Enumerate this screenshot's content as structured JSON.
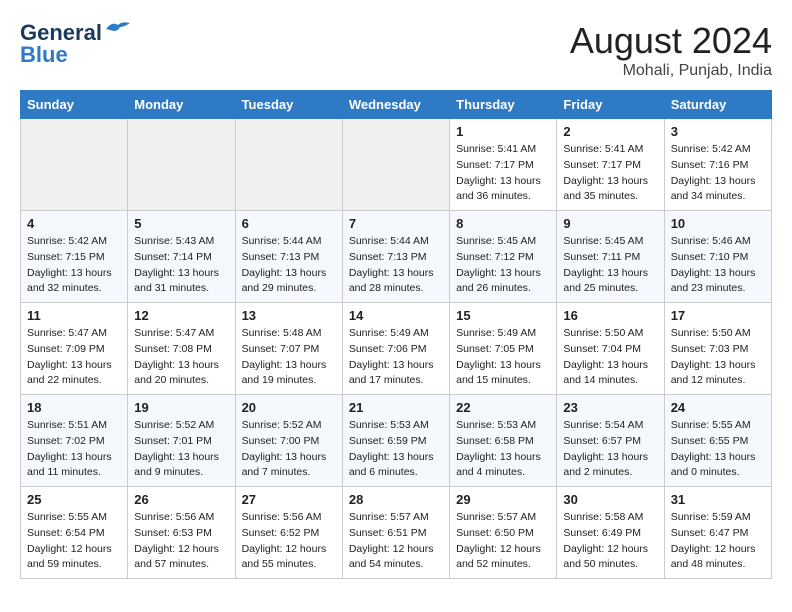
{
  "header": {
    "logo_general": "General",
    "logo_blue": "Blue",
    "month_year": "August 2024",
    "location": "Mohali, Punjab, India"
  },
  "days_of_week": [
    "Sunday",
    "Monday",
    "Tuesday",
    "Wednesday",
    "Thursday",
    "Friday",
    "Saturday"
  ],
  "weeks": [
    [
      {
        "day": "",
        "empty": true
      },
      {
        "day": "",
        "empty": true
      },
      {
        "day": "",
        "empty": true
      },
      {
        "day": "",
        "empty": true
      },
      {
        "day": "1",
        "sunrise": "5:41 AM",
        "sunset": "7:17 PM",
        "daylight": "13 hours and 36 minutes."
      },
      {
        "day": "2",
        "sunrise": "5:41 AM",
        "sunset": "7:17 PM",
        "daylight": "13 hours and 35 minutes."
      },
      {
        "day": "3",
        "sunrise": "5:42 AM",
        "sunset": "7:16 PM",
        "daylight": "13 hours and 34 minutes."
      }
    ],
    [
      {
        "day": "4",
        "sunrise": "5:42 AM",
        "sunset": "7:15 PM",
        "daylight": "13 hours and 32 minutes."
      },
      {
        "day": "5",
        "sunrise": "5:43 AM",
        "sunset": "7:14 PM",
        "daylight": "13 hours and 31 minutes."
      },
      {
        "day": "6",
        "sunrise": "5:44 AM",
        "sunset": "7:13 PM",
        "daylight": "13 hours and 29 minutes."
      },
      {
        "day": "7",
        "sunrise": "5:44 AM",
        "sunset": "7:13 PM",
        "daylight": "13 hours and 28 minutes."
      },
      {
        "day": "8",
        "sunrise": "5:45 AM",
        "sunset": "7:12 PM",
        "daylight": "13 hours and 26 minutes."
      },
      {
        "day": "9",
        "sunrise": "5:45 AM",
        "sunset": "7:11 PM",
        "daylight": "13 hours and 25 minutes."
      },
      {
        "day": "10",
        "sunrise": "5:46 AM",
        "sunset": "7:10 PM",
        "daylight": "13 hours and 23 minutes."
      }
    ],
    [
      {
        "day": "11",
        "sunrise": "5:47 AM",
        "sunset": "7:09 PM",
        "daylight": "13 hours and 22 minutes."
      },
      {
        "day": "12",
        "sunrise": "5:47 AM",
        "sunset": "7:08 PM",
        "daylight": "13 hours and 20 minutes."
      },
      {
        "day": "13",
        "sunrise": "5:48 AM",
        "sunset": "7:07 PM",
        "daylight": "13 hours and 19 minutes."
      },
      {
        "day": "14",
        "sunrise": "5:49 AM",
        "sunset": "7:06 PM",
        "daylight": "13 hours and 17 minutes."
      },
      {
        "day": "15",
        "sunrise": "5:49 AM",
        "sunset": "7:05 PM",
        "daylight": "13 hours and 15 minutes."
      },
      {
        "day": "16",
        "sunrise": "5:50 AM",
        "sunset": "7:04 PM",
        "daylight": "13 hours and 14 minutes."
      },
      {
        "day": "17",
        "sunrise": "5:50 AM",
        "sunset": "7:03 PM",
        "daylight": "13 hours and 12 minutes."
      }
    ],
    [
      {
        "day": "18",
        "sunrise": "5:51 AM",
        "sunset": "7:02 PM",
        "daylight": "13 hours and 11 minutes."
      },
      {
        "day": "19",
        "sunrise": "5:52 AM",
        "sunset": "7:01 PM",
        "daylight": "13 hours and 9 minutes."
      },
      {
        "day": "20",
        "sunrise": "5:52 AM",
        "sunset": "7:00 PM",
        "daylight": "13 hours and 7 minutes."
      },
      {
        "day": "21",
        "sunrise": "5:53 AM",
        "sunset": "6:59 PM",
        "daylight": "13 hours and 6 minutes."
      },
      {
        "day": "22",
        "sunrise": "5:53 AM",
        "sunset": "6:58 PM",
        "daylight": "13 hours and 4 minutes."
      },
      {
        "day": "23",
        "sunrise": "5:54 AM",
        "sunset": "6:57 PM",
        "daylight": "13 hours and 2 minutes."
      },
      {
        "day": "24",
        "sunrise": "5:55 AM",
        "sunset": "6:55 PM",
        "daylight": "13 hours and 0 minutes."
      }
    ],
    [
      {
        "day": "25",
        "sunrise": "5:55 AM",
        "sunset": "6:54 PM",
        "daylight": "12 hours and 59 minutes."
      },
      {
        "day": "26",
        "sunrise": "5:56 AM",
        "sunset": "6:53 PM",
        "daylight": "12 hours and 57 minutes."
      },
      {
        "day": "27",
        "sunrise": "5:56 AM",
        "sunset": "6:52 PM",
        "daylight": "12 hours and 55 minutes."
      },
      {
        "day": "28",
        "sunrise": "5:57 AM",
        "sunset": "6:51 PM",
        "daylight": "12 hours and 54 minutes."
      },
      {
        "day": "29",
        "sunrise": "5:57 AM",
        "sunset": "6:50 PM",
        "daylight": "12 hours and 52 minutes."
      },
      {
        "day": "30",
        "sunrise": "5:58 AM",
        "sunset": "6:49 PM",
        "daylight": "12 hours and 50 minutes."
      },
      {
        "day": "31",
        "sunrise": "5:59 AM",
        "sunset": "6:47 PM",
        "daylight": "12 hours and 48 minutes."
      }
    ]
  ]
}
